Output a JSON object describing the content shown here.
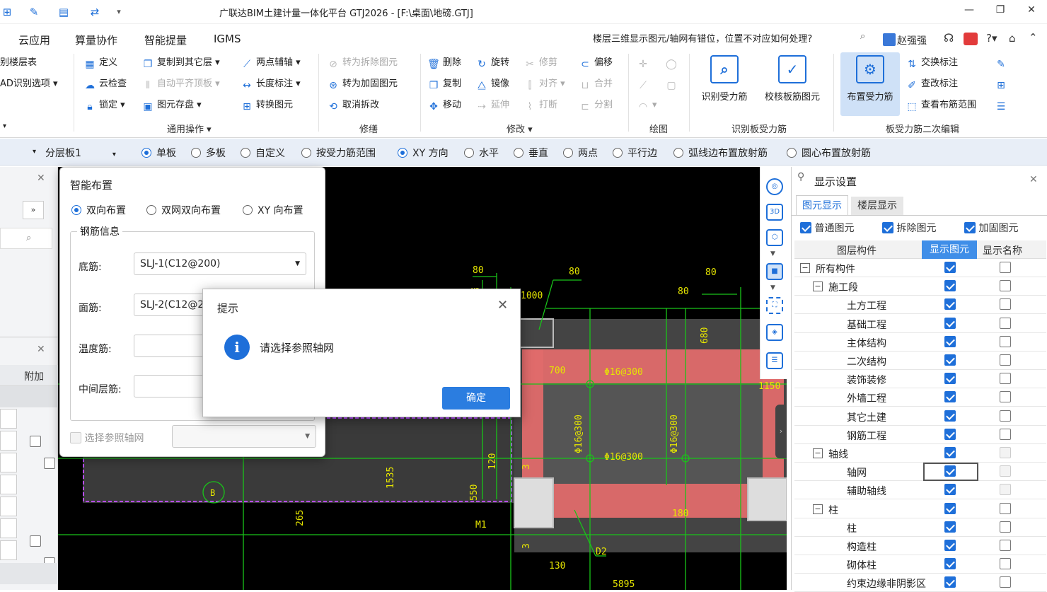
{
  "window": {
    "title": "广联达BIM土建计量一体化平台 GTJ2026 - [F:\\桌面\\地磅.GTJ]",
    "minimize": "—",
    "restore": "❐",
    "close": "✕"
  },
  "menu": {
    "items": [
      "云应用",
      "算量协作",
      "智能提量",
      "IGMS"
    ],
    "help_question": "楼层三维显示图元/轴网有错位，位置不对应如何处理?",
    "user": "赵强强"
  },
  "ribbon": {
    "col0": [
      "别楼层表",
      "AD识别选项"
    ],
    "general": {
      "label": "通用操作",
      "buttons": [
        "定义",
        "云检查",
        "锁定",
        "复制到其它层",
        "自动平齐顶板",
        "图元存盘",
        "两点辅轴",
        "长度标注",
        "转换图元"
      ]
    },
    "repair": {
      "label": "修缮",
      "buttons": [
        "转为拆除图元",
        "转为加固图元",
        "取消拆改"
      ]
    },
    "modify": {
      "label": "修改",
      "buttons": [
        "删除",
        "复制",
        "移动",
        "旋转",
        "镜像",
        "延伸",
        "修剪",
        "对齐",
        "打断",
        "偏移",
        "合并",
        "分割"
      ]
    },
    "draw": {
      "label": "绘图"
    },
    "identify": {
      "label": "识别板受力筋",
      "buttons": [
        "识别受力筋",
        "校核板筋图元"
      ]
    },
    "secondary": {
      "label": "板受力筋二次编辑",
      "buttons": [
        "布置受力筋",
        "交换标注",
        "查改标注",
        "查看布筋范围"
      ]
    }
  },
  "optbar": {
    "layer": "分层板1",
    "scope_options": [
      "单板",
      "多板",
      "自定义",
      "按受力筋范围"
    ],
    "direction_options": [
      "XY 方向",
      "水平",
      "垂直",
      "两点",
      "平行边",
      "弧线边布置放射筋",
      "圆心布置放射筋"
    ]
  },
  "left": {
    "col_header": "附加"
  },
  "smart_dialog": {
    "title": "智能布置",
    "modes": [
      "双向布置",
      "双网双向布置",
      "XY 向布置"
    ],
    "group_label": "钢筋信息",
    "bottom_label": "底筋:",
    "bottom_value": "SLJ-1(C12@200)",
    "top_label": "面筋:",
    "top_value": "SLJ-2(C12@200)",
    "temp_label": "温度筋:",
    "middle_label": "中间层筋:",
    "ref_axis_label": "选择参照轴网"
  },
  "tip_dialog": {
    "title": "提示",
    "message": "请选择参照轴网",
    "ok": "确定"
  },
  "cad_labels": {
    "dims": [
      "80",
      "80",
      "80",
      "80",
      "1000",
      "700",
      "1150",
      "680",
      "1535",
      "265",
      "550",
      "120",
      "3",
      "3",
      "180",
      "130",
      "5895"
    ],
    "rebar": [
      "Φ16@300",
      "Φ16@300",
      "Φ16@300",
      "Φ16@300"
    ],
    "tags": [
      "M1",
      "D2",
      "B",
      "M2"
    ]
  },
  "display_settings": {
    "title": "显示设置",
    "tabs": [
      "图元显示",
      "楼层显示"
    ],
    "checks": [
      "普通图元",
      "拆除图元",
      "加固图元"
    ],
    "headers": [
      "图层构件",
      "显示图元",
      "显示名称"
    ],
    "rows": [
      {
        "name": "所有构件",
        "level": 0,
        "expand": "−",
        "show": true,
        "name_on": false,
        "dim": false
      },
      {
        "name": "施工段",
        "level": 1,
        "expand": "−",
        "show": true,
        "name_on": false,
        "dim": false
      },
      {
        "name": "土方工程",
        "level": 2,
        "expand": "",
        "show": true,
        "name_on": false,
        "dim": false
      },
      {
        "name": "基础工程",
        "level": 2,
        "expand": "",
        "show": true,
        "name_on": false,
        "dim": false
      },
      {
        "name": "主体结构",
        "level": 2,
        "expand": "",
        "show": true,
        "name_on": false,
        "dim": false
      },
      {
        "name": "二次结构",
        "level": 2,
        "expand": "",
        "show": true,
        "name_on": false,
        "dim": false
      },
      {
        "name": "装饰装修",
        "level": 2,
        "expand": "",
        "show": true,
        "name_on": false,
        "dim": false
      },
      {
        "name": "外墙工程",
        "level": 2,
        "expand": "",
        "show": true,
        "name_on": false,
        "dim": false
      },
      {
        "name": "其它土建",
        "level": 2,
        "expand": "",
        "show": true,
        "name_on": false,
        "dim": false
      },
      {
        "name": "钢筋工程",
        "level": 2,
        "expand": "",
        "show": true,
        "name_on": false,
        "dim": false
      },
      {
        "name": "轴线",
        "level": 1,
        "expand": "−",
        "show": true,
        "name_on": false,
        "dim": true
      },
      {
        "name": "轴网",
        "level": 2,
        "expand": "",
        "show": true,
        "name_on": false,
        "dim": true
      },
      {
        "name": "辅助轴线",
        "level": 2,
        "expand": "",
        "show": true,
        "name_on": false,
        "dim": true
      },
      {
        "name": "柱",
        "level": 1,
        "expand": "−",
        "show": true,
        "name_on": false,
        "dim": false
      },
      {
        "name": "柱",
        "level": 2,
        "expand": "",
        "show": true,
        "name_on": false,
        "dim": false
      },
      {
        "name": "构造柱",
        "level": 2,
        "expand": "",
        "show": true,
        "name_on": false,
        "dim": false
      },
      {
        "name": "砌体柱",
        "level": 2,
        "expand": "",
        "show": true,
        "name_on": false,
        "dim": false
      },
      {
        "name": "约束边缘非阴影区",
        "level": 2,
        "expand": "",
        "show": true,
        "name_on": false,
        "dim": false
      }
    ]
  }
}
